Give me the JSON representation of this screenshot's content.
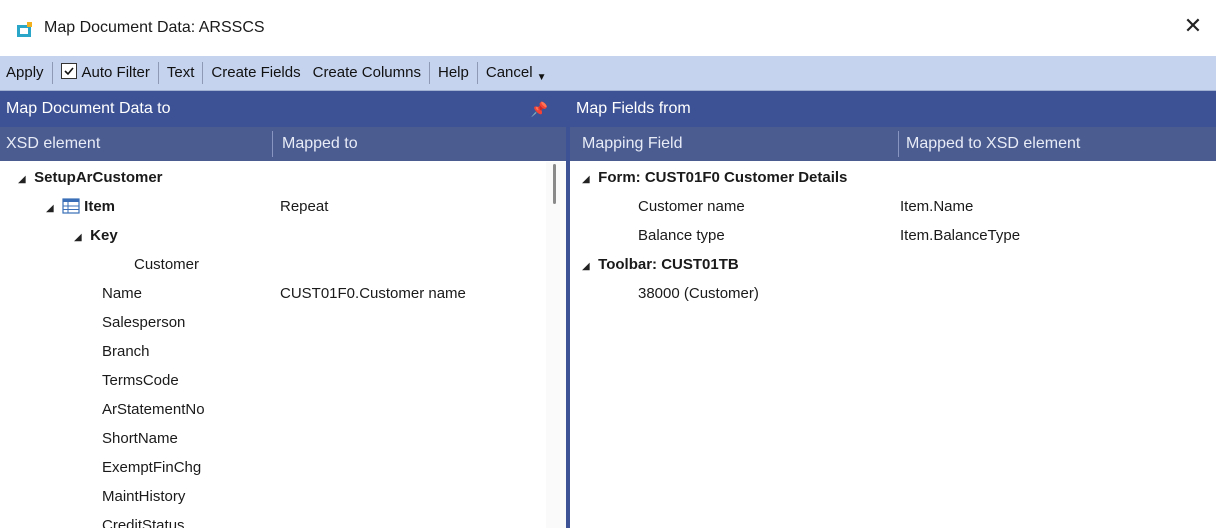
{
  "window": {
    "title": "Map Document Data: ARSSCS",
    "close": "✕"
  },
  "toolbar": {
    "apply": "Apply",
    "auto_filter": "Auto Filter",
    "auto_filter_checked": true,
    "text": "Text",
    "create_fields": "Create Fields",
    "create_columns": "Create Columns",
    "help": "Help",
    "cancel": "Cancel"
  },
  "left_pane": {
    "title": "Map Document Data to",
    "columns": {
      "xsd_element": "XSD element",
      "mapped_to": "Mapped to"
    },
    "rows": [
      {
        "label": "SetupArCustomer",
        "mapped": ""
      },
      {
        "label": "Item",
        "mapped": "Repeat"
      },
      {
        "label": "Key",
        "mapped": ""
      },
      {
        "label": "Customer",
        "mapped": ""
      },
      {
        "label": "Name",
        "mapped": "CUST01F0.Customer name"
      },
      {
        "label": "Salesperson",
        "mapped": ""
      },
      {
        "label": "Branch",
        "mapped": ""
      },
      {
        "label": "TermsCode",
        "mapped": ""
      },
      {
        "label": "ArStatementNo",
        "mapped": ""
      },
      {
        "label": "ShortName",
        "mapped": ""
      },
      {
        "label": "ExemptFinChg",
        "mapped": ""
      },
      {
        "label": "MaintHistory",
        "mapped": ""
      },
      {
        "label": "CreditStatus",
        "mapped": ""
      }
    ]
  },
  "right_pane": {
    "title": "Map Fields from",
    "columns": {
      "mapping_field": "Mapping Field",
      "mapped_to_xsd": "Mapped to XSD element"
    },
    "rows": [
      {
        "label": "Form: CUST01F0 Customer Details",
        "mapped": ""
      },
      {
        "label": "Customer name",
        "mapped": "Item.Name"
      },
      {
        "label": "Balance type",
        "mapped": "Item.BalanceType"
      },
      {
        "label": "Toolbar: CUST01TB",
        "mapped": ""
      },
      {
        "label": "38000 (Customer)",
        "mapped": ""
      }
    ]
  },
  "colors": {
    "header_bg": "#3d5294",
    "column_bg": "#4b5c91",
    "toolbar_bg": "#c5d3ee"
  }
}
